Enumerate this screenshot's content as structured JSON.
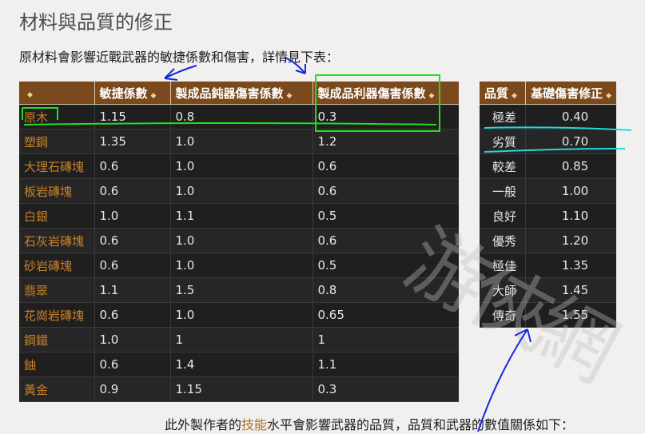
{
  "title": "材料與品質的修正",
  "intro": "原材料會影響近戰武器的敏捷係數和傷害，詳情見下表：",
  "materials_table": {
    "headers": [
      "",
      "敏捷係數",
      "製成品鈍器傷害係數",
      "製成品利器傷害係數"
    ],
    "rows": [
      [
        "原木",
        "1.15",
        "0.8",
        "0.3"
      ],
      [
        "塑鋼",
        "1.35",
        "1.0",
        "1.2"
      ],
      [
        "大理石磚塊",
        "0.6",
        "1.0",
        "0.6"
      ],
      [
        "板岩磚塊",
        "0.6",
        "1.0",
        "0.6"
      ],
      [
        "白銀",
        "1.0",
        "1.1",
        "0.5"
      ],
      [
        "石灰岩磚塊",
        "0.6",
        "1.0",
        "0.6"
      ],
      [
        "砂岩磚塊",
        "0.6",
        "1.0",
        "0.5"
      ],
      [
        "翡翠",
        "1.1",
        "1.5",
        "0.8"
      ],
      [
        "花崗岩磚塊",
        "0.6",
        "1.0",
        "0.65"
      ],
      [
        "鋼鐵",
        "1.0",
        "1",
        "1"
      ],
      [
        "鈾",
        "0.6",
        "1.4",
        "1.1"
      ],
      [
        "黃金",
        "0.9",
        "1.15",
        "0.3"
      ]
    ]
  },
  "quality_table": {
    "headers": [
      "品質",
      "基礎傷害修正"
    ],
    "rows": [
      [
        "極差",
        "0.40"
      ],
      [
        "劣質",
        "0.70"
      ],
      [
        "較差",
        "0.85"
      ],
      [
        "一般",
        "1.00"
      ],
      [
        "良好",
        "1.10"
      ],
      [
        "優秀",
        "1.20"
      ],
      [
        "極佳",
        "1.35"
      ],
      [
        "大師",
        "1.45"
      ],
      [
        "傳奇",
        "1.55"
      ]
    ]
  },
  "footer": {
    "before": "此外製作者的",
    "highlight": "技能",
    "after": "水平會影響武器的品質，品質和武器的數值關係如下："
  },
  "watermark": "游俠網",
  "colors": {
    "header_bg": "#7a4a1c",
    "cell_bg": "#1f1f1f",
    "material_text": "#c9802a",
    "annotation_green": "#22dd22",
    "annotation_blue": "#1428e0",
    "annotation_cyan": "#22d8d8"
  }
}
